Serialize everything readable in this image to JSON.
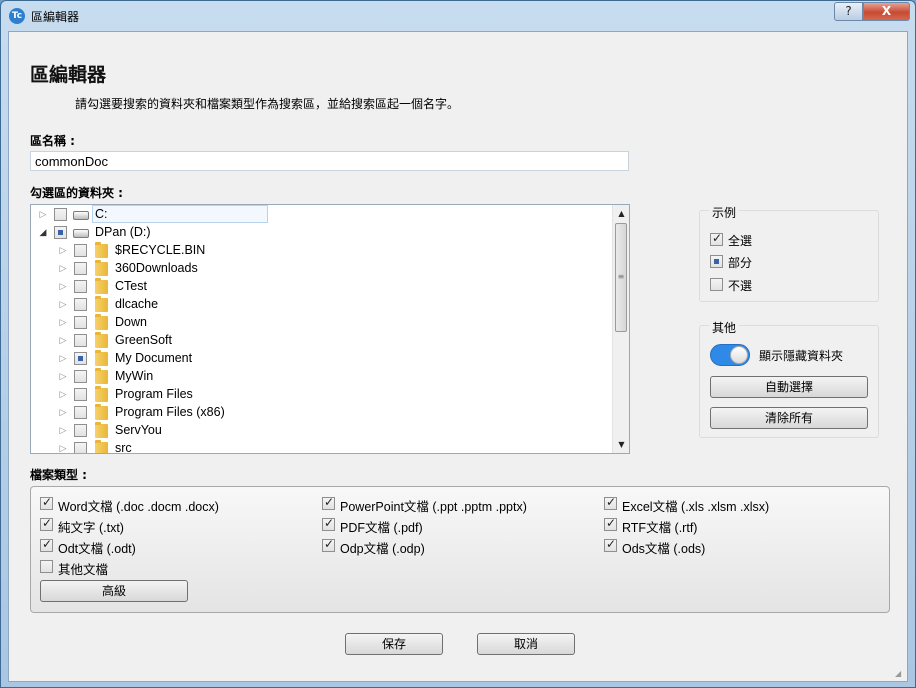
{
  "window": {
    "title": "區編輯器",
    "icon_text": "Tc",
    "help_label": "?",
    "close_label": "X"
  },
  "header": {
    "heading": "區編輯器",
    "description": "請勾選要搜索的資料夾和檔案類型作為搜索區，並給搜索區起一個名字。"
  },
  "name_field": {
    "label": "區名稱 :",
    "value": "commonDoc"
  },
  "folders": {
    "label": "勾選區的資料夾 :",
    "drives": [
      {
        "label": "C:",
        "state": "unchecked",
        "expanded": false
      },
      {
        "label": "DPan (D:)",
        "state": "partial",
        "expanded": true
      }
    ],
    "children": [
      {
        "label": "$RECYCLE.BIN",
        "state": "unchecked"
      },
      {
        "label": "360Downloads",
        "state": "unchecked"
      },
      {
        "label": "CTest",
        "state": "unchecked"
      },
      {
        "label": "dlcache",
        "state": "unchecked"
      },
      {
        "label": "Down",
        "state": "unchecked"
      },
      {
        "label": "GreenSoft",
        "state": "unchecked"
      },
      {
        "label": "My Document",
        "state": "partial"
      },
      {
        "label": "MyWin",
        "state": "unchecked"
      },
      {
        "label": "Program Files",
        "state": "unchecked"
      },
      {
        "label": "Program Files (x86)",
        "state": "unchecked"
      },
      {
        "label": "ServYou",
        "state": "unchecked"
      },
      {
        "label": "src",
        "state": "unchecked"
      }
    ]
  },
  "example": {
    "title": "示例",
    "items": [
      {
        "label": "全選",
        "state": "checked"
      },
      {
        "label": "部分",
        "state": "partial"
      },
      {
        "label": "不選",
        "state": "unchecked"
      }
    ]
  },
  "other": {
    "title": "其他",
    "toggle_label": "顯示隱藏資料夾",
    "toggle_on": true,
    "auto_select_label": "自動選擇",
    "clear_all_label": "清除所有"
  },
  "file_types": {
    "label": "檔案類型 :",
    "items": [
      {
        "label": "Word文檔 (.doc .docm .docx)",
        "checked": true
      },
      {
        "label": "PowerPoint文檔 (.ppt .pptm .pptx)",
        "checked": true
      },
      {
        "label": "Excel文檔 (.xls .xlsm .xlsx)",
        "checked": true
      },
      {
        "label": "純文字 (.txt)",
        "checked": true
      },
      {
        "label": "PDF文檔 (.pdf)",
        "checked": true
      },
      {
        "label": "RTF文檔 (.rtf)",
        "checked": true
      },
      {
        "label": "Odt文檔 (.odt)",
        "checked": true
      },
      {
        "label": "Odp文檔 (.odp)",
        "checked": true
      },
      {
        "label": "Ods文檔 (.ods)",
        "checked": true
      },
      {
        "label": "其他文檔",
        "checked": false
      }
    ],
    "advanced_label": "高級"
  },
  "footer": {
    "save_label": "保存",
    "cancel_label": "取消"
  },
  "colors": {
    "toggle_on": "#2f89e6",
    "partial_mark": "#3a62a8",
    "title_bar": "#c7dcef"
  }
}
